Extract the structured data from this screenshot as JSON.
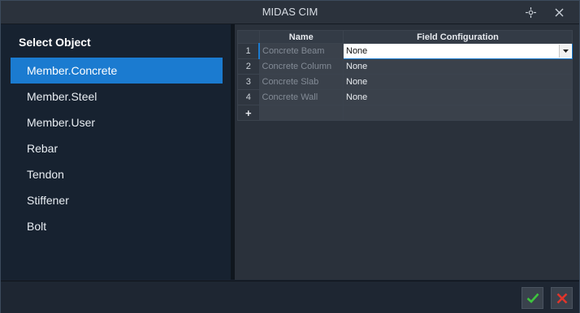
{
  "window": {
    "title": "MIDAS CIM"
  },
  "titlebar": {
    "move_icon": "move-icon",
    "close_icon": "close-icon"
  },
  "left_panel": {
    "title": "Select Object",
    "items": [
      {
        "label": "Member.Concrete",
        "selected": true
      },
      {
        "label": "Member.Steel"
      },
      {
        "label": "Member.User"
      },
      {
        "label": "Rebar"
      },
      {
        "label": "Tendon"
      },
      {
        "label": "Stiffener"
      },
      {
        "label": "Bolt"
      }
    ]
  },
  "grid": {
    "headers": {
      "name": "Name",
      "field": "Field Configuration"
    },
    "rows": [
      {
        "num": "1",
        "name": "Concrete Beam",
        "value": "None"
      },
      {
        "num": "2",
        "name": "Concrete Column",
        "value": "None"
      },
      {
        "num": "3",
        "name": "Concrete Slab",
        "value": "None"
      },
      {
        "num": "4",
        "name": "Concrete Wall",
        "value": "None"
      }
    ],
    "add_row": "+"
  },
  "footer": {
    "ok_icon": "check-icon",
    "cancel_icon": "x-icon"
  },
  "colors": {
    "accent": "#1b7bd0",
    "ok": "#3ec43e",
    "cancel": "#e0352b"
  }
}
